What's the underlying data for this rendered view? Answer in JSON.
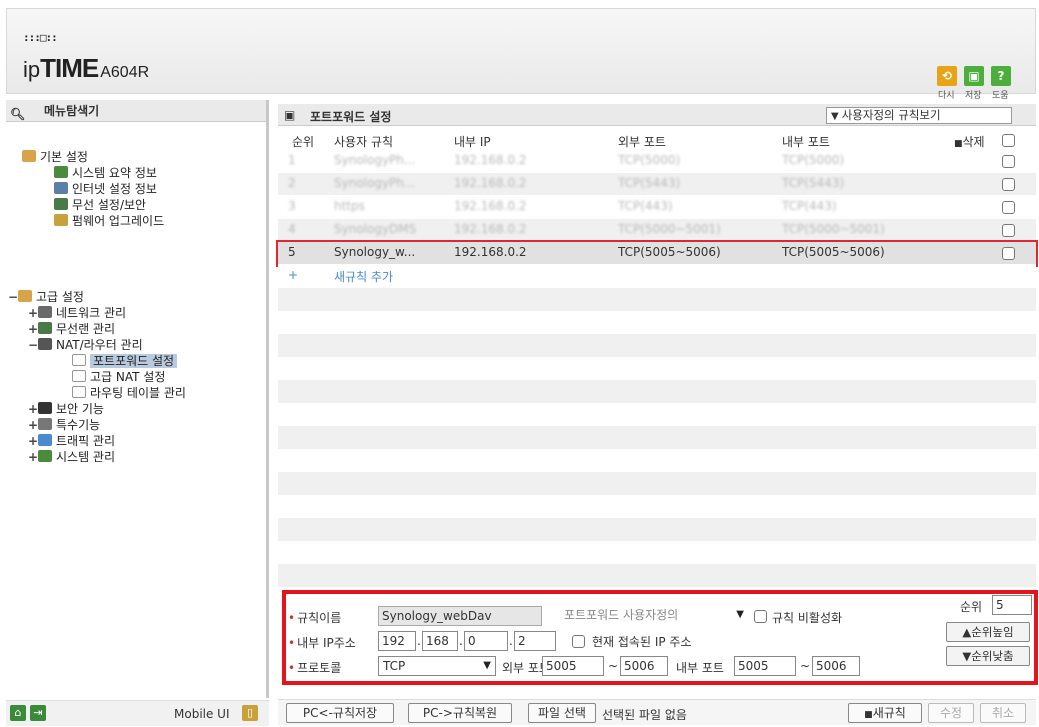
{
  "header": {
    "logo_mark": ":::□::",
    "logo_prefix": "ip",
    "logo_main": "TIME",
    "logo_model": "A604R",
    "actions": [
      {
        "label": "다시",
        "icon": "refresh-icon",
        "color": "#e8a317"
      },
      {
        "label": "저장",
        "icon": "save-icon",
        "color": "#4caf3c"
      },
      {
        "label": "도움",
        "icon": "help-icon",
        "color": "#4caf3c"
      }
    ]
  },
  "sidebar": {
    "title": "메뉴탐색기",
    "basic": {
      "label": "기본 설정",
      "items": [
        "시스템 요약 정보",
        "인터넷 설정 정보",
        "무선 설정/보안",
        "펌웨어 업그레이드"
      ]
    },
    "advanced": {
      "label": "고급 설정",
      "items": [
        {
          "label": "네트워크 관리",
          "prefix": "+"
        },
        {
          "label": "무선랜 관리",
          "prefix": "+"
        },
        {
          "label": "NAT/라우터 관리",
          "prefix": "−"
        }
      ],
      "nat_children": [
        "포트포워드 설정",
        "고급 NAT 설정",
        "라우팅 테이블 관리"
      ],
      "more": [
        {
          "label": "보안 기능",
          "prefix": "+"
        },
        {
          "label": "특수기능",
          "prefix": "+"
        },
        {
          "label": "트래픽 관리",
          "prefix": "+"
        },
        {
          "label": "시스템 관리",
          "prefix": "+"
        }
      ]
    },
    "footer": {
      "mobile_label": "Mobile UI"
    }
  },
  "main": {
    "title": "포트포워드 설정",
    "view_select": "사용자정의 규칙보기",
    "columns": {
      "order": "순위",
      "rule": "사용자 규칙",
      "internal_ip": "내부 IP",
      "external_port": "외부 포트",
      "internal_port": "내부 포트",
      "delete": "삭제"
    },
    "rows": [
      {
        "order": "1",
        "rule": "SynologyPh...",
        "ip": "192.168.0.2",
        "ext": "TCP(5000)",
        "int": "TCP(5000)",
        "blurred": true
      },
      {
        "order": "2",
        "rule": "SynologyPh...",
        "ip": "192.168.0.2",
        "ext": "TCP(5443)",
        "int": "TCP(5443)",
        "blurred": true
      },
      {
        "order": "3",
        "rule": "https",
        "ip": "192.168.0.2",
        "ext": "TCP(443)",
        "int": "TCP(443)",
        "blurred": true
      },
      {
        "order": "4",
        "rule": "SynologyDMS",
        "ip": "192.168.0.2",
        "ext": "TCP(5000~5001)",
        "int": "TCP(5000~5001)",
        "blurred": true
      },
      {
        "order": "5",
        "rule": "Synology_w...",
        "ip": "192.168.0.2",
        "ext": "TCP(5005~5006)",
        "int": "TCP(5005~5006)",
        "blurred": false
      }
    ],
    "add_rule": "새규칙 추가"
  },
  "form": {
    "rule_name_label": "규칙이름",
    "rule_name_value": "Synology_webDav",
    "preset_select": "포트포워드 사용자정의",
    "disable_label": "규칙 비활성화",
    "order_label": "순위",
    "order_value": "5",
    "ip_label": "내부 IP주소",
    "ip": [
      "192",
      "168",
      "0",
      "2"
    ],
    "current_ip_label": "현재 접속된 IP 주소",
    "up_button": "▲순위높임",
    "protocol_label": "프로토콜",
    "protocol_value": "TCP",
    "ext_port_label": "외부 포트",
    "ext_from": "5005",
    "ext_to": "5006",
    "int_port_label": "내부 포트",
    "int_from": "5005",
    "int_to": "5006",
    "down_button": "▼순위낮춤"
  },
  "bottom": {
    "save_pc": "PC<-규칙저장",
    "restore_pc": "PC->규칙복원",
    "file_select": "파일 선택",
    "no_file": "선택된 파일 없음",
    "new_rule": "새규칙",
    "modify": "수정",
    "cancel": "취소"
  }
}
